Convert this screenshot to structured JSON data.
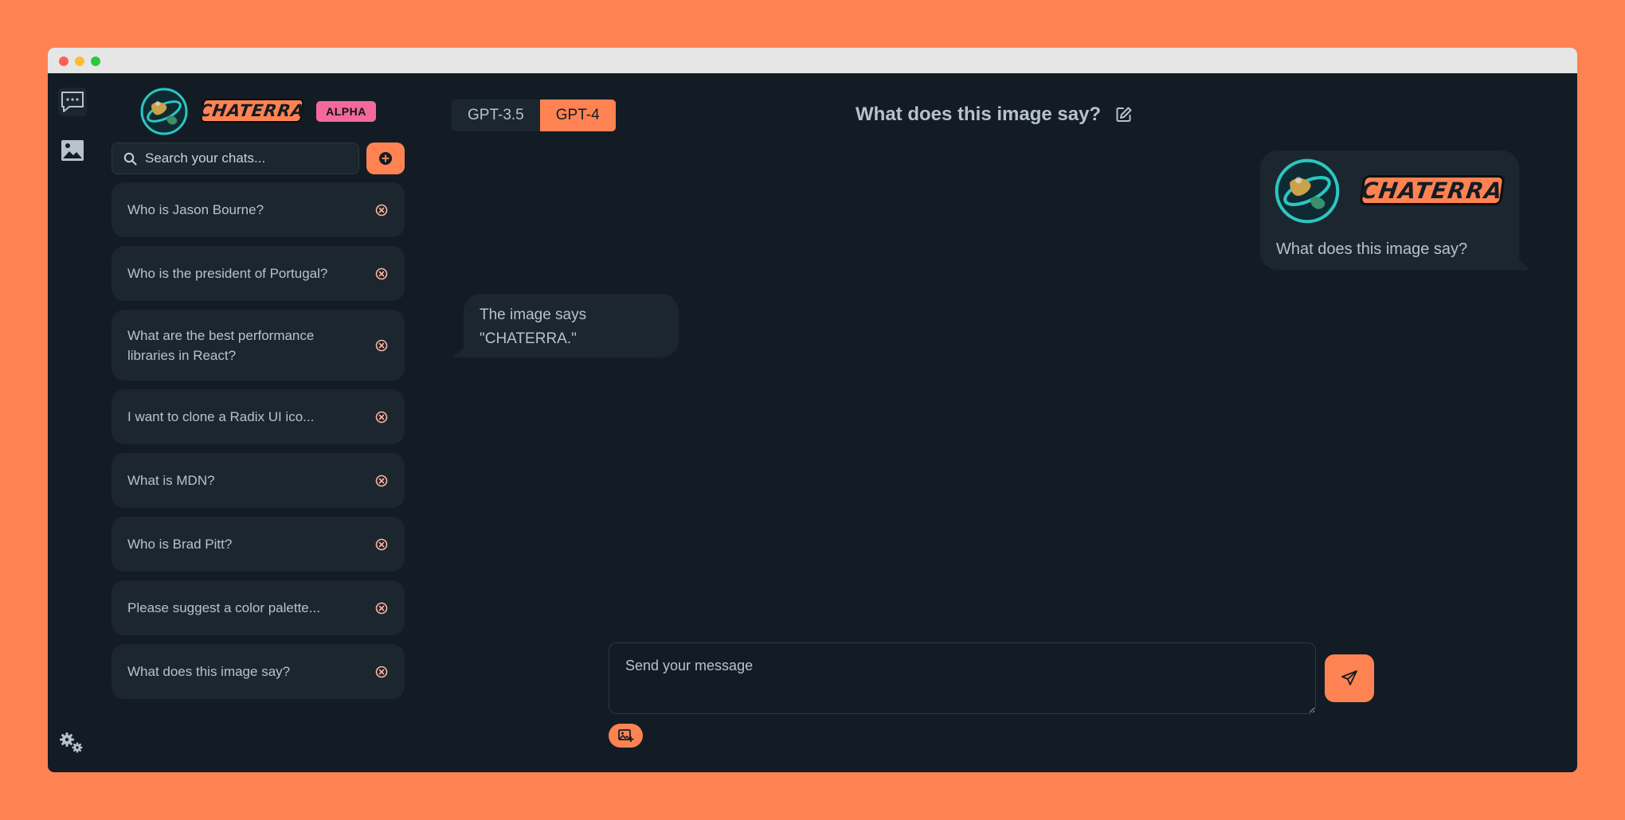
{
  "app": {
    "logo_text": "CHATERRA",
    "badge": "ALPHA"
  },
  "colors": {
    "accent": "#ff8352",
    "badge": "#f4699b",
    "background": "#131c24",
    "surface": "#1c262e",
    "text": "#b6c2cc"
  },
  "rail": {
    "icons": [
      "chat-bubble-icon",
      "image-icon",
      "settings-gears-icon"
    ]
  },
  "sidebar": {
    "search_placeholder": "Search your chats...",
    "new_chat_icon": "plus-circle-icon",
    "chats": [
      {
        "label": "Who is Jason Bourne?"
      },
      {
        "label": "Who is the president of Portugal?"
      },
      {
        "label": "What are the best performance libraries in React?"
      },
      {
        "label": "I want to clone a Radix UI ico..."
      },
      {
        "label": "What is MDN?"
      },
      {
        "label": "Who is Brad Pitt?"
      },
      {
        "label": "Please suggest a color palette..."
      },
      {
        "label": "What does this image say?"
      }
    ]
  },
  "header": {
    "models": [
      {
        "label": "GPT-3.5",
        "selected": false
      },
      {
        "label": "GPT-4",
        "selected": true
      }
    ],
    "title": "What does this image say?"
  },
  "messages": [
    {
      "role": "user",
      "image_text": "CHATERRA",
      "text": "What does this image say?"
    },
    {
      "role": "assistant",
      "text": "The image says \"CHATERRA.\""
    }
  ],
  "composer": {
    "placeholder": "Send your message"
  }
}
